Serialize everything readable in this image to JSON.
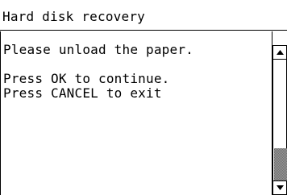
{
  "window": {
    "title": "Hard disk recovery"
  },
  "message": {
    "line1": "Please unload the paper.",
    "line2": "",
    "line3": "Press OK to continue.",
    "line4": "Press CANCEL to exit"
  },
  "scrollbar": {
    "up_icon": "up-arrow-icon",
    "down_icon": "down-arrow-icon",
    "thumb_start": 0.73,
    "thumb_end": 1.0
  }
}
